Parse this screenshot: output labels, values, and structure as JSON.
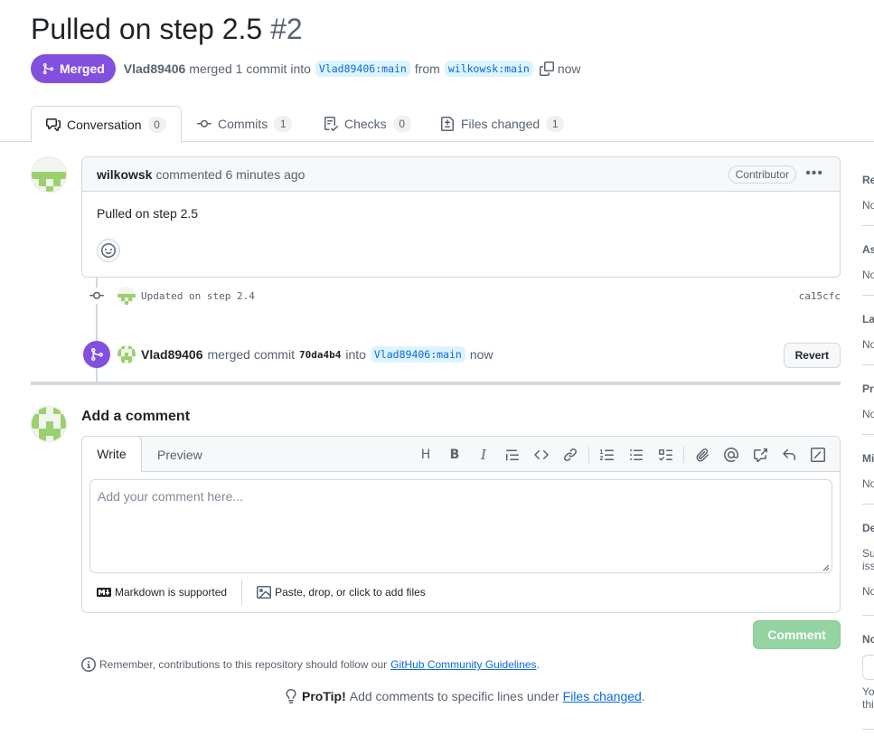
{
  "pr": {
    "title": "Pulled on step 2.5",
    "number": "#2",
    "state_label": "Merged",
    "author": "Vlad89406",
    "summary": "merged 1 commit into",
    "base_branch": "Vlad89406:main",
    "from_label": "from",
    "head_branch": "wilkowsk:main",
    "time": "now"
  },
  "tabs": [
    {
      "label": "Conversation",
      "count": "0"
    },
    {
      "label": "Commits",
      "count": "1"
    },
    {
      "label": "Checks",
      "count": "0"
    },
    {
      "label": "Files changed",
      "count": "1"
    }
  ],
  "comment": {
    "author": "wilkowsk",
    "time": "commented 6 minutes ago",
    "role": "Contributor",
    "body": "Pulled on step 2.5"
  },
  "commit_event": {
    "message": "Updated on step 2.4",
    "sha": "ca15cfc"
  },
  "merge_event": {
    "author": "Vlad89406",
    "text": "merged commit",
    "sha": "70da4b4",
    "into": "into",
    "branch": "Vlad89406:main",
    "time": "now",
    "revert_label": "Revert"
  },
  "add_comment": {
    "title": "Add a comment",
    "tab_write": "Write",
    "tab_preview": "Preview",
    "placeholder": "Add your comment here...",
    "markdown_note": "Markdown is supported",
    "attach_note": "Paste, drop, or click to add files",
    "submit_label": "Comment",
    "guideline_prefix": "Remember, contributions to this repository should follow our",
    "guideline_link": "GitHub Community Guidelines",
    "guideline_suffix": ".",
    "protip_label": "ProTip!",
    "protip_text": "Add comments to specific lines under",
    "protip_link": "Files changed",
    "protip_suffix": "."
  },
  "sidebar": {
    "sections": [
      {
        "head": "Re",
        "value": "No"
      },
      {
        "head": "As",
        "value": "No"
      },
      {
        "head": "La",
        "value": "No"
      },
      {
        "head": "Pr",
        "value": "No"
      },
      {
        "head": "Mi",
        "value": "No"
      },
      {
        "head": "De",
        "value": "Su"
      },
      {
        "head": "No",
        "value": "Yo"
      }
    ],
    "extra": [
      "iss",
      "No",
      "thi"
    ]
  },
  "colors": {
    "merged": "#8250df",
    "link": "#0969da",
    "branch_bg": "#ddf4ff",
    "comment_btn": "#94d3a2"
  }
}
